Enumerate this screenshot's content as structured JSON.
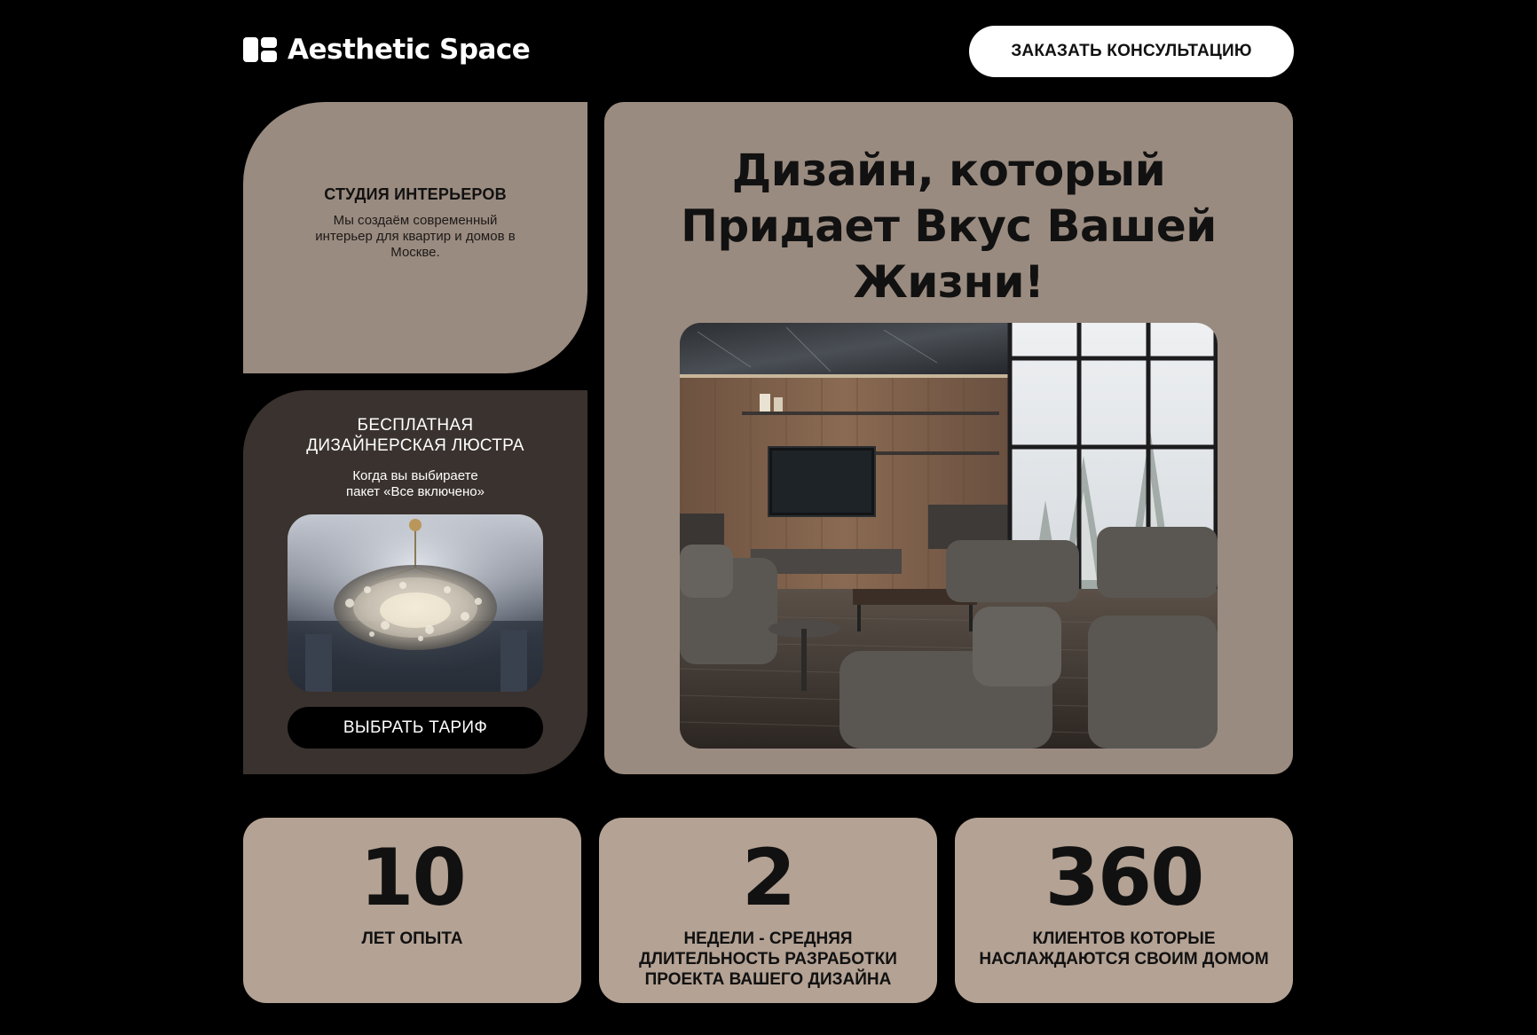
{
  "header": {
    "brand": "Aesthetic Space",
    "logo_icon": "grid-blocks-icon",
    "cta_label": "ЗАКАЗАТЬ КОНСУЛЬТАЦИЮ"
  },
  "studio_card": {
    "title": "СТУДИЯ ИНТЕРЬЕРОВ",
    "description": "Мы создаём современный интерьер для квартир и домов в Москве."
  },
  "promo_card": {
    "title_lines": [
      "БЕСПЛАТНАЯ",
      "ДИЗАЙНЕРСКАЯ ЛЮСТРА"
    ],
    "description_lines": [
      "Когда вы выбираете",
      "пакет «Все включено»"
    ],
    "button_label": "ВЫБРАТЬ ТАРИФ"
  },
  "hero": {
    "title_lines": [
      "Дизайн, который",
      "Придает Вкус Вашей",
      "Жизни!"
    ]
  },
  "stats": [
    {
      "number": "10",
      "label_lines": [
        "ЛЕТ ОПЫТА"
      ]
    },
    {
      "number": "2",
      "label_lines": [
        "НЕДЕЛИ - СРЕДНЯЯ",
        "ДЛИТЕЛЬНОСТЬ РАЗРАБОТКИ",
        "ПРОЕКТА ВАШЕГО ДИЗАЙНА"
      ]
    },
    {
      "number": "360",
      "label_lines": [
        "КЛИЕНТОВ КОТОРЫЕ",
        "НАСЛАЖДАЮТСЯ СВОИМ ДОМОМ"
      ]
    }
  ],
  "colors": {
    "page_background": "#000000",
    "card_taupe": "#9a8b80",
    "card_dark": "#3a322e",
    "stat_card": "#b4a294",
    "button_light": "#ffffff",
    "button_dark": "#000000"
  }
}
